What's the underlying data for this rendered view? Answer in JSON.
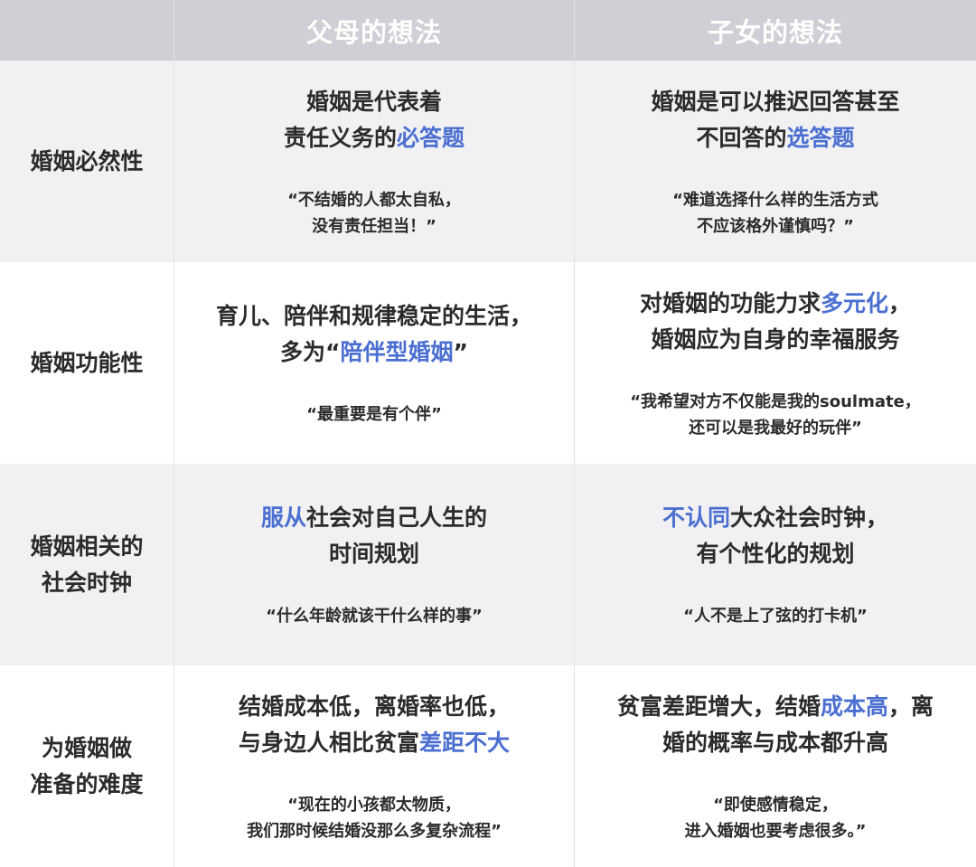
{
  "header": {
    "col_parents": "父母的想法",
    "col_children": "子女的想法"
  },
  "rows": [
    {
      "label": [
        "婚姻必然性"
      ],
      "parents": {
        "main": [
          [
            {
              "t": "婚姻是代表着"
            }
          ],
          [
            {
              "t": "责任义务的"
            },
            {
              "t": "必答题",
              "hl": true
            }
          ]
        ],
        "quote": [
          "“不结婚的人都太自私，",
          "没有责任担当！”"
        ]
      },
      "children": {
        "main": [
          [
            {
              "t": "婚姻是可以推迟回答甚至"
            }
          ],
          [
            {
              "t": "不回答的"
            },
            {
              "t": "选答题",
              "hl": true
            }
          ]
        ],
        "quote": [
          "“难道选择什么样的生活方式",
          "不应该格外谨慎吗？”"
        ]
      }
    },
    {
      "label": [
        "婚姻功能性"
      ],
      "parents": {
        "main": [
          [
            {
              "t": "育儿、陪伴和规律稳定的生活，"
            }
          ],
          [
            {
              "t": "多为“"
            },
            {
              "t": "陪伴型婚姻",
              "hl": true
            },
            {
              "t": "”"
            }
          ]
        ],
        "quote": [
          "“最重要是有个伴”"
        ]
      },
      "children": {
        "main": [
          [
            {
              "t": "对婚姻的功能力求"
            },
            {
              "t": "多元化",
              "hl": true
            },
            {
              "t": "，"
            }
          ],
          [
            {
              "t": "婚姻应为自身的幸福服务"
            }
          ]
        ],
        "quote": [
          "“我希望对方不仅能是我的soulmate，",
          "还可以是我最好的玩伴”"
        ]
      }
    },
    {
      "label": [
        "婚姻相关的",
        "社会时钟"
      ],
      "parents": {
        "main": [
          [
            {
              "t": "服从",
              "hl": true
            },
            {
              "t": "社会对自己人生的"
            }
          ],
          [
            {
              "t": "时间规划"
            }
          ]
        ],
        "quote": [
          "“什么年龄就该干什么样的事”"
        ]
      },
      "children": {
        "main": [
          [
            {
              "t": "不认同",
              "hl": true
            },
            {
              "t": "大众社会时钟，"
            }
          ],
          [
            {
              "t": "有个性化的规划"
            }
          ]
        ],
        "quote": [
          "“人不是上了弦的打卡机”"
        ]
      }
    },
    {
      "label": [
        "为婚姻做",
        "准备的难度"
      ],
      "parents": {
        "main": [
          [
            {
              "t": "结婚成本低，离婚率也低，"
            }
          ],
          [
            {
              "t": "与身边人相比贫富"
            },
            {
              "t": "差距不大",
              "hl": true
            }
          ]
        ],
        "quote": [
          "“现在的小孩都太物质，",
          "我们那时候结婚没那么多复杂流程”"
        ]
      },
      "children": {
        "main": [
          [
            {
              "t": "贫富差距增大，结婚"
            },
            {
              "t": "成本高",
              "hl": true
            },
            {
              "t": "，离"
            }
          ],
          [
            {
              "t": "婚的概率与成本都升高"
            }
          ]
        ],
        "quote": [
          "“即使感情稳定，",
          "进入婚姻也要考虑很多。”"
        ]
      }
    }
  ]
}
